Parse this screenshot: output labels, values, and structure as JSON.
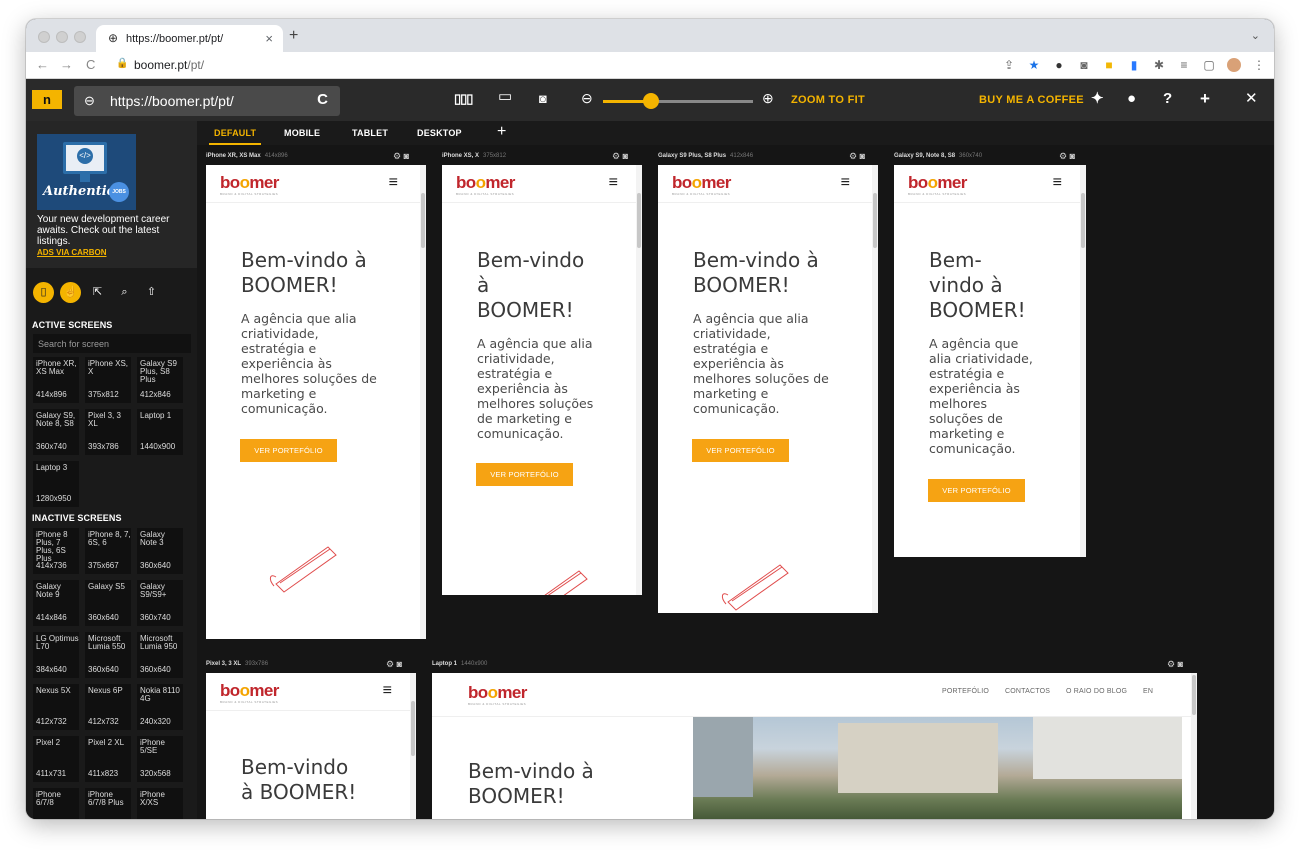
{
  "browser": {
    "tab_title": "https://boomer.pt/pt/",
    "tab_close": "×",
    "new_tab": "+",
    "tab_menu": "⌄",
    "url_host": "boomer.pt",
    "url_path": "/pt/",
    "back": "←",
    "forward": "→",
    "reload": "C",
    "lock": "🔒",
    "extension_icons": [
      "share-icon",
      "bookmark-star-icon",
      "extension-icon",
      "camera-extension-icon",
      "terminal-extension-icon",
      "window-extension-icon",
      "puzzle-icon",
      "reading-list-icon",
      "side-panel-icon",
      "profile-avatar",
      "menu-dots-icon"
    ]
  },
  "toolbar": {
    "logo": "n",
    "url": "https://boomer.pt/pt/",
    "link_icon": "⊖",
    "reload_icon": "C",
    "zoom_fit": "ZOOM TO FIT",
    "zoom_level": 0.32,
    "buy_coffee": "BUY ME A COFFEE",
    "icons": [
      "layout-icon",
      "device-frame-icon",
      "screenshot-icon",
      "zoom-out-icon",
      "zoom-in-icon",
      "twitter-icon",
      "github-icon",
      "help-icon",
      "add-icon",
      "close-icon"
    ]
  },
  "sidebar": {
    "ad_monitor": "</>",
    "ad_script": "Authentic",
    "ad_badge": "JOBS",
    "ad_text": "Your new development career awaits. Check out the latest listings.",
    "ad_link": "ADS VIA CARBON",
    "mode_icons": [
      "device-mode-icon",
      "touch-mode-icon",
      "inspect-icon",
      "search-icon",
      "upload-icon"
    ],
    "active_heading": "ACTIVE SCREENS",
    "search_placeholder": "Search for screen",
    "active_screens": [
      {
        "name": "iPhone XR, XS Max",
        "size": "414x896"
      },
      {
        "name": "iPhone XS, X",
        "size": "375x812"
      },
      {
        "name": "Galaxy S9 Plus, S8 Plus",
        "size": "412x846"
      },
      {
        "name": "Galaxy S9, Note 8, S8",
        "size": "360x740"
      },
      {
        "name": "Pixel 3, 3 XL",
        "size": "393x786"
      },
      {
        "name": "Laptop 1",
        "size": "1440x900"
      },
      {
        "name": "Laptop 3",
        "size": "1280x950"
      }
    ],
    "inactive_heading": "INACTIVE SCREENS",
    "inactive_screens": [
      {
        "name": "iPhone 8 Plus, 7 Plus, 6S Plus",
        "size": "414x736"
      },
      {
        "name": "iPhone 8, 7, 6S, 6",
        "size": "375x667"
      },
      {
        "name": "Galaxy Note 3",
        "size": "360x640"
      },
      {
        "name": "Galaxy Note 9",
        "size": "414x846"
      },
      {
        "name": "Galaxy S5",
        "size": "360x640"
      },
      {
        "name": "Galaxy S9/S9+",
        "size": "360x740"
      },
      {
        "name": "LG Optimus L70",
        "size": "384x640"
      },
      {
        "name": "Microsoft Lumia 550",
        "size": "360x640"
      },
      {
        "name": "Microsoft Lumia 950",
        "size": "360x640"
      },
      {
        "name": "Nexus 5X",
        "size": "412x732"
      },
      {
        "name": "Nexus 6P",
        "size": "412x732"
      },
      {
        "name": "Nokia 8110 4G",
        "size": "240x320"
      },
      {
        "name": "Pixel 2",
        "size": "411x731"
      },
      {
        "name": "Pixel 2 XL",
        "size": "411x823"
      },
      {
        "name": "iPhone 5/SE",
        "size": "320x568"
      },
      {
        "name": "iPhone 6/7/8",
        "size": ""
      },
      {
        "name": "iPhone 6/7/8 Plus",
        "size": ""
      },
      {
        "name": "iPhone X/XS",
        "size": ""
      }
    ]
  },
  "device_tabs": {
    "items": [
      "DEFAULT",
      "MOBILE",
      "TABLET",
      "DESKTOP"
    ],
    "active": "DEFAULT",
    "add": "+"
  },
  "site": {
    "brand_a": "bo",
    "brand_b": "o",
    "brand_c": "mer",
    "tagline": "BRAND & DIGITAL STRATEGIES",
    "menu_icon": "≡",
    "cta": "VER PORTEFÓLIO",
    "nav": [
      "PORTEFÓLIO",
      "CONTACTOS",
      "O RAIO DO BLOG",
      "EN"
    ],
    "colors": {
      "brand": "#c0262c",
      "accent": "#f6a313"
    }
  },
  "frames": [
    {
      "label": "iPhone XR, XS Max",
      "size": "414x896",
      "title_lines": [
        "Bem-vindo à",
        "BOOMER!"
      ],
      "sub_lines": [
        "A agência que alia",
        "criatividade,",
        "estratégia e",
        "experiência às",
        "melhores soluções de",
        "marketing e",
        "comunicação."
      ]
    },
    {
      "label": "iPhone XS, X",
      "size": "375x812",
      "title_lines": [
        "Bem-vindo",
        "à",
        "BOOMER!"
      ],
      "sub_lines": [
        "A agência que alia",
        "criatividade,",
        "estratégia e",
        "experiência às",
        "melhores soluções",
        "de marketing e",
        "comunicação."
      ]
    },
    {
      "label": "Galaxy S9 Plus, S8 Plus",
      "size": "412x846",
      "title_lines": [
        "Bem-vindo à",
        "BOOMER!"
      ],
      "sub_lines": [
        "A agência que alia",
        "criatividade,",
        "estratégia e",
        "experiência às",
        "melhores soluções de",
        "marketing e",
        "comunicação."
      ]
    },
    {
      "label": "Galaxy S9, Note 8, S8",
      "size": "360x740",
      "title_lines": [
        "Bem-",
        "vindo à",
        "BOOMER!"
      ],
      "sub_lines": [
        "A agência que",
        "alia criatividade,",
        "estratégia e",
        "experiência às",
        "melhores",
        "soluções de",
        "marketing e",
        "comunicação."
      ]
    },
    {
      "label": "Pixel 3, 3 XL",
      "size": "393x786",
      "title_lines": [
        "Bem-vindo",
        "à BOOMER!"
      ]
    },
    {
      "label": "Laptop 1",
      "size": "1440x900",
      "title_lines": [
        "Bem-vindo à",
        "BOOMER!"
      ]
    }
  ]
}
